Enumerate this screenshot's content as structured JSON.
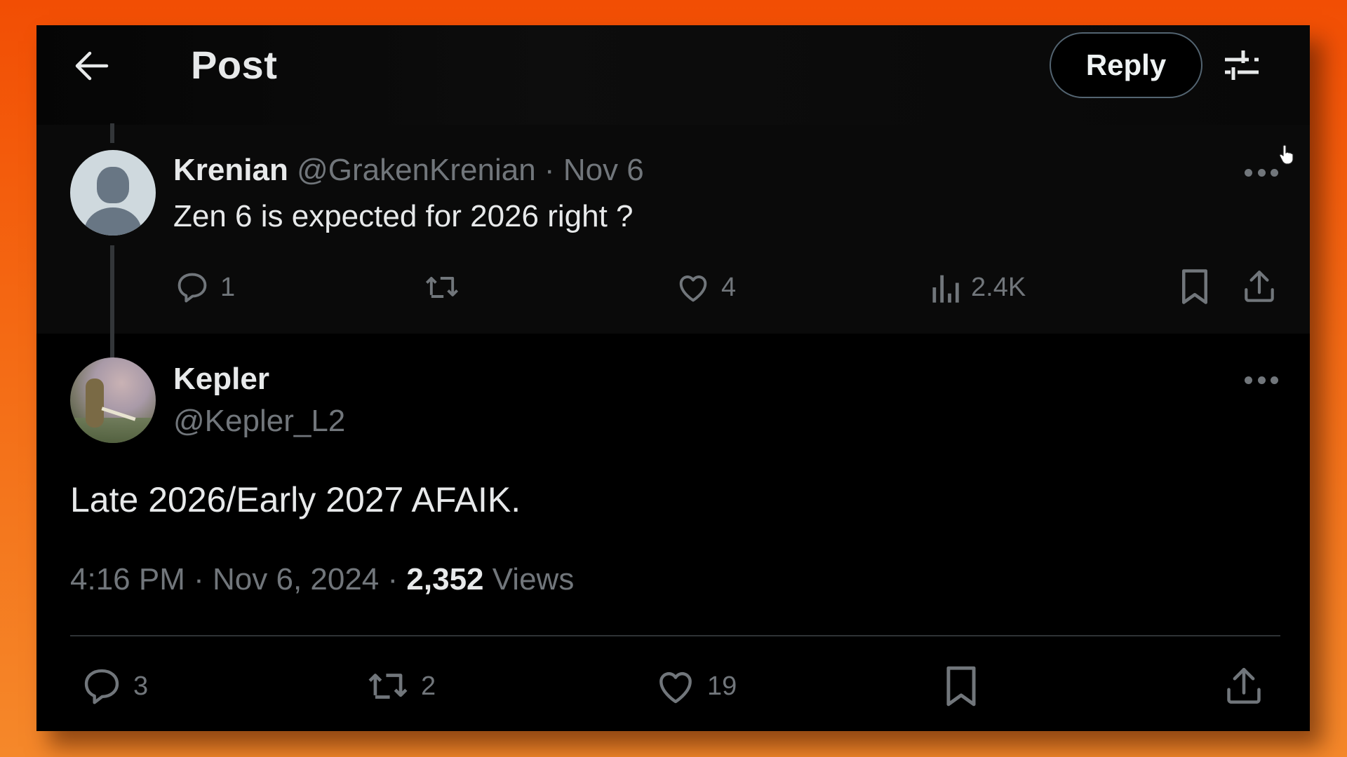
{
  "header": {
    "title": "Post",
    "reply_label": "Reply",
    "icons": {
      "back": "arrow-left-icon",
      "filter": "sliders-icon"
    }
  },
  "parent_post": {
    "author_name": "Krenian",
    "handle": "@GrakenKrenian",
    "separator": "·",
    "date": "Nov 6",
    "text": "Zen 6 is expected for 2026 right ?",
    "actions": {
      "replies": "1",
      "reposts": "",
      "likes": "4",
      "views": "2.4K"
    }
  },
  "main_post": {
    "author_name": "Kepler",
    "handle": "@Kepler_L2",
    "text": "Late 2026/Early 2027 AFAIK.",
    "time": "4:16 PM",
    "separator": "·",
    "date": "Nov 6, 2024",
    "views_count": "2,352",
    "views_label": "Views",
    "actions": {
      "replies": "3",
      "reposts": "2",
      "likes": "19"
    }
  },
  "colors": {
    "background_top": "#f24e04",
    "background_bottom": "#f5882a",
    "panel": "#000000",
    "parent_bg": "#0a0a0a",
    "text_primary": "#e7e9ea",
    "text_muted": "#71767b",
    "border": "#536471"
  }
}
